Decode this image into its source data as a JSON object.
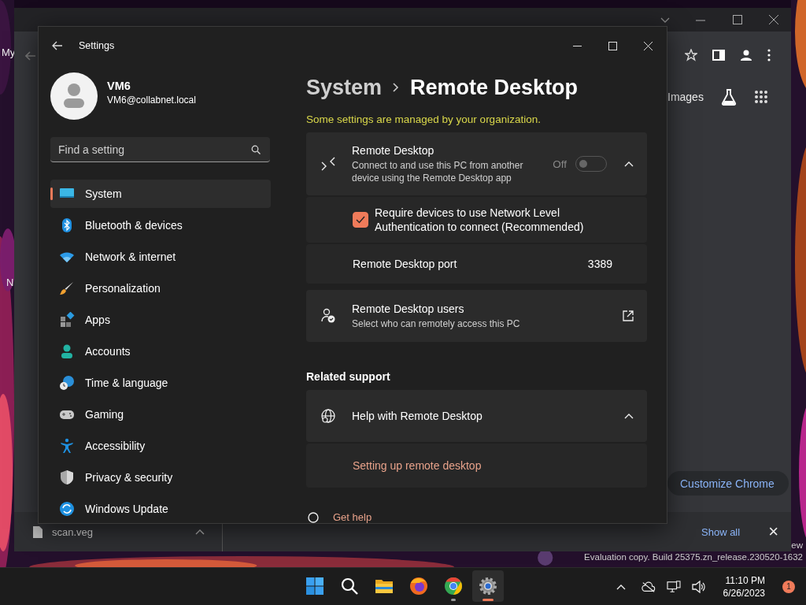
{
  "desktop": {
    "labels": [
      "My",
      "N"
    ],
    "watermark": [
      "ew",
      "Evaluation copy. Build 25375.zn_release.230520-1632"
    ]
  },
  "browser": {
    "link": "Images",
    "customize_button": "Customize Chrome",
    "downloads": {
      "file": "scan.veg",
      "show_all": "Show all",
      "close": "×"
    }
  },
  "settings": {
    "title": "Settings",
    "user": {
      "name": "VM6",
      "email": "VM6@collabnet.local"
    },
    "search": {
      "placeholder": "Find a setting"
    },
    "nav": [
      {
        "label": "System",
        "kind": "system",
        "selected": true
      },
      {
        "label": "Bluetooth & devices",
        "kind": "bluetooth",
        "selected": false
      },
      {
        "label": "Network & internet",
        "kind": "network",
        "selected": false
      },
      {
        "label": "Personalization",
        "kind": "brush",
        "selected": false
      },
      {
        "label": "Apps",
        "kind": "apps",
        "selected": false
      },
      {
        "label": "Accounts",
        "kind": "accounts",
        "selected": false
      },
      {
        "label": "Time & language",
        "kind": "time",
        "selected": false
      },
      {
        "label": "Gaming",
        "kind": "gaming",
        "selected": false
      },
      {
        "label": "Accessibility",
        "kind": "accessibility",
        "selected": false
      },
      {
        "label": "Privacy & security",
        "kind": "privacy",
        "selected": false
      },
      {
        "label": "Windows Update",
        "kind": "update",
        "selected": false
      }
    ],
    "breadcrumb": {
      "parent": "System",
      "current": "Remote Desktop"
    },
    "notice": "Some settings are managed by your organization.",
    "remote_desktop": {
      "title": "Remote Desktop",
      "description": "Connect to and use this PC from another device using the Remote Desktop app",
      "state_label": "Off",
      "on": false,
      "expanded": true,
      "nla": {
        "label": "Require devices to use Network Level Authentication to connect (Recommended)",
        "checked": true
      },
      "port": {
        "label": "Remote Desktop port",
        "value": "3389"
      }
    },
    "users": {
      "title": "Remote Desktop users",
      "description": "Select who can remotely access this PC"
    },
    "related": {
      "heading": "Related support",
      "help": {
        "title": "Help with Remote Desktop",
        "expanded": true,
        "links": [
          "Setting up remote desktop"
        ]
      }
    },
    "get_help": "Get help"
  },
  "taskbar": {
    "apps": [
      {
        "kind": "start",
        "running": false,
        "active": false
      },
      {
        "kind": "search",
        "running": false,
        "active": false
      },
      {
        "kind": "explorer",
        "running": false,
        "active": false
      },
      {
        "kind": "firefox",
        "running": false,
        "active": false
      },
      {
        "kind": "chrome",
        "running": true,
        "active": false
      },
      {
        "kind": "settings",
        "running": true,
        "active": true
      }
    ],
    "time": "11:10 PM",
    "date": "6/26/2023",
    "notification_count": "1"
  }
}
